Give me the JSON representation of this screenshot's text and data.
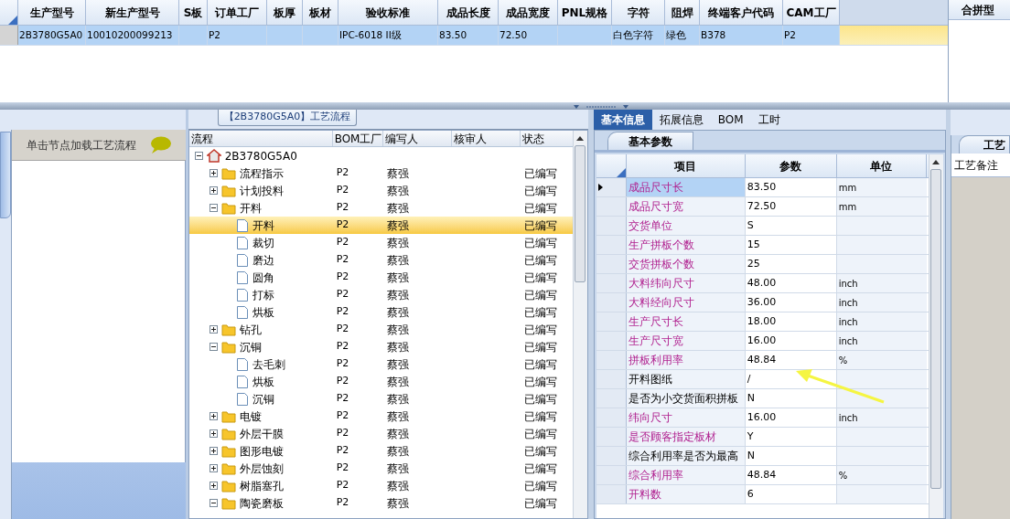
{
  "top_table": {
    "columns": [
      "生产型号",
      "新生产型号",
      "S板",
      "订单工厂",
      "板厚",
      "板材",
      "验收标准",
      "成品长度",
      "成品宽度",
      "PNL规格",
      "字符",
      "阻焊",
      "终端客户代码",
      "CAM工厂"
    ],
    "rows": [
      {
        "selected": true,
        "cells": [
          "2B3780G5A0",
          "10010200099213",
          null,
          "P2",
          null,
          null,
          "IPC-6018 II级",
          "83.50",
          "72.50",
          null,
          "白色字符",
          "绿色",
          "B378",
          "P2"
        ]
      }
    ]
  },
  "merge_panel": {
    "title": "合拼型"
  },
  "hint_panel": {
    "hint": "单击节点加载工艺流程"
  },
  "flow_panel": {
    "title": "【2B3780G5A0】工艺流程",
    "columns": [
      "流程",
      "BOM工厂",
      "编写人",
      "核审人",
      "状态"
    ],
    "tree": [
      {
        "label": "2B3780G5A0",
        "kind": "root",
        "expanded": true,
        "selected": false,
        "children": [
          {
            "label": "流程指示",
            "kind": "folder",
            "expanded": false,
            "selected": false,
            "bom": "P2",
            "writer": "蔡强",
            "status": "已编写"
          },
          {
            "label": "计划投料",
            "kind": "folder",
            "expanded": false,
            "selected": false,
            "bom": "P2",
            "writer": "蔡强",
            "status": "已编写"
          },
          {
            "label": "开料",
            "kind": "folder",
            "expanded": true,
            "selected": false,
            "bom": "P2",
            "writer": "蔡强",
            "status": "已编写",
            "children": [
              {
                "label": "开料",
                "kind": "step",
                "selected": true,
                "bom": "P2",
                "writer": "蔡强",
                "status": "已编写"
              },
              {
                "label": "裁切",
                "kind": "step",
                "selected": false,
                "bom": "P2",
                "writer": "蔡强",
                "status": "已编写"
              },
              {
                "label": "磨边",
                "kind": "step",
                "selected": false,
                "bom": "P2",
                "writer": "蔡强",
                "status": "已编写"
              },
              {
                "label": "圆角",
                "kind": "step",
                "selected": false,
                "bom": "P2",
                "writer": "蔡强",
                "status": "已编写"
              },
              {
                "label": "打标",
                "kind": "step",
                "selected": false,
                "bom": "P2",
                "writer": "蔡强",
                "status": "已编写"
              },
              {
                "label": "烘板",
                "kind": "step",
                "selected": false,
                "bom": "P2",
                "writer": "蔡强",
                "status": "已编写"
              }
            ]
          },
          {
            "label": "钻孔",
            "kind": "folder",
            "expanded": false,
            "selected": false,
            "bom": "P2",
            "writer": "蔡强",
            "status": "已编写"
          },
          {
            "label": "沉铜",
            "kind": "folder",
            "expanded": true,
            "selected": false,
            "bom": "P2",
            "writer": "蔡强",
            "status": "已编写",
            "children": [
              {
                "label": "去毛刺",
                "kind": "step",
                "selected": false,
                "bom": "P2",
                "writer": "蔡强",
                "status": "已编写"
              },
              {
                "label": "烘板",
                "kind": "step",
                "selected": false,
                "bom": "P2",
                "writer": "蔡强",
                "status": "已编写"
              },
              {
                "label": "沉铜",
                "kind": "step",
                "selected": false,
                "bom": "P2",
                "writer": "蔡强",
                "status": "已编写"
              }
            ]
          },
          {
            "label": "电镀",
            "kind": "folder",
            "expanded": false,
            "selected": false,
            "bom": "P2",
            "writer": "蔡强",
            "status": "已编写"
          },
          {
            "label": "外层干膜",
            "kind": "folder",
            "expanded": false,
            "selected": false,
            "bom": "P2",
            "writer": "蔡强",
            "status": "已编写"
          },
          {
            "label": "图形电镀",
            "kind": "folder",
            "expanded": false,
            "selected": false,
            "bom": "P2",
            "writer": "蔡强",
            "status": "已编写"
          },
          {
            "label": "外层蚀刻",
            "kind": "folder",
            "expanded": false,
            "selected": false,
            "bom": "P2",
            "writer": "蔡强",
            "status": "已编写"
          },
          {
            "label": "树脂塞孔",
            "kind": "folder",
            "expanded": false,
            "selected": false,
            "bom": "P2",
            "writer": "蔡强",
            "status": "已编写"
          },
          {
            "label": "陶瓷磨板",
            "kind": "folder",
            "expanded": true,
            "selected": false,
            "bom": "P2",
            "writer": "蔡强",
            "status": "已编写"
          }
        ]
      }
    ]
  },
  "info_panel": {
    "tabs": [
      {
        "label": "基本信息",
        "selected": true
      },
      {
        "label": "拓展信息",
        "selected": false
      },
      {
        "label": "BOM",
        "selected": false
      },
      {
        "label": "工时",
        "selected": false
      }
    ],
    "subtab": "基本参数",
    "columns": [
      "项目",
      "参数",
      "单位"
    ],
    "rows": [
      {
        "name": "成品尺寸长",
        "value": "83.50",
        "unit": "mm",
        "emphasized": true,
        "selected": true
      },
      {
        "name": "成品尺寸宽",
        "value": "72.50",
        "unit": "mm",
        "emphasized": true,
        "selected": false
      },
      {
        "name": "交货单位",
        "value": "S",
        "emphasized": true,
        "selected": false
      },
      {
        "name": "生产拼板个数",
        "value": "15",
        "emphasized": true,
        "selected": false
      },
      {
        "name": "交货拼板个数",
        "value": "25",
        "emphasized": true,
        "selected": false
      },
      {
        "name": "大料纬向尺寸",
        "value": "48.00",
        "unit": "inch",
        "emphasized": true,
        "selected": false
      },
      {
        "name": "大料经向尺寸",
        "value": "36.00",
        "unit": "inch",
        "emphasized": true,
        "selected": false
      },
      {
        "name": "生产尺寸长",
        "value": "18.00",
        "unit": "inch",
        "emphasized": true,
        "selected": false
      },
      {
        "name": "生产尺寸宽",
        "value": "16.00",
        "unit": "inch",
        "emphasized": true,
        "selected": false
      },
      {
        "name": "拼板利用率",
        "value": "48.84",
        "unit": "%",
        "emphasized": true,
        "selected": false
      },
      {
        "name": "开料图纸",
        "value": "/",
        "emphasized": false,
        "selected": false
      },
      {
        "name": "是否为小交货面积拼板",
        "value": "N",
        "emphasized": false,
        "selected": false
      },
      {
        "name": "纬向尺寸",
        "value": "16.00",
        "unit": "inch",
        "emphasized": true,
        "selected": false
      },
      {
        "name": "是否顾客指定板材",
        "value": "Y",
        "emphasized": true,
        "selected": false
      },
      {
        "name": "综合利用率是否为最高",
        "value": "N",
        "emphasized": false,
        "selected": false
      },
      {
        "name": "综合利用率",
        "value": "48.84",
        "unit": "%",
        "emphasized": true,
        "selected": false
      },
      {
        "name": "开料数",
        "value": "6",
        "emphasized": true,
        "selected": false
      }
    ]
  },
  "notes_panel": {
    "tab": "工艺",
    "label": "工艺备注"
  }
}
